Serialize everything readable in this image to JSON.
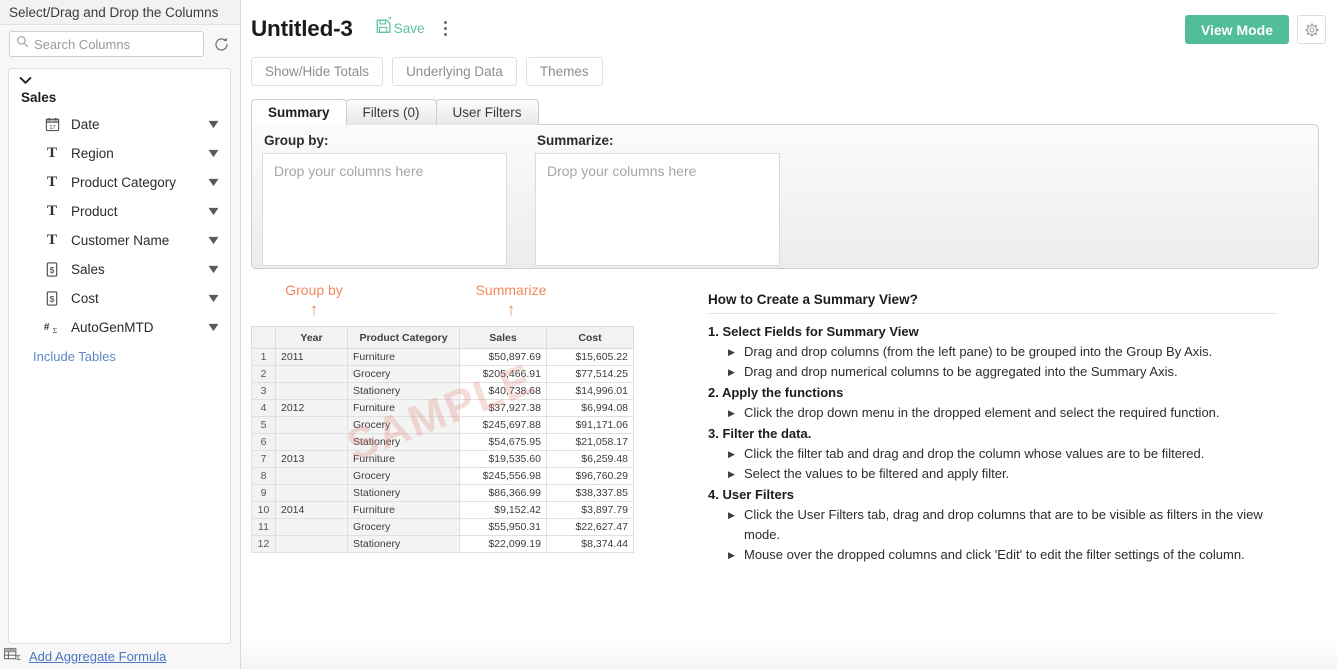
{
  "sidebar": {
    "header": "Select/Drag and Drop the Columns",
    "search": {
      "placeholder": "Search Columns",
      "value": ""
    },
    "refresh_icon": "refresh-icon",
    "group": {
      "name": "Sales",
      "expanded": true
    },
    "columns": [
      {
        "label": "Date",
        "type_icon": "calendar-icon"
      },
      {
        "label": "Region",
        "type_icon": "text-icon"
      },
      {
        "label": "Product Category",
        "type_icon": "text-icon"
      },
      {
        "label": "Product",
        "type_icon": "text-icon"
      },
      {
        "label": "Customer Name",
        "type_icon": "text-icon"
      },
      {
        "label": "Sales",
        "type_icon": "currency-icon"
      },
      {
        "label": "Cost",
        "type_icon": "currency-icon"
      },
      {
        "label": "AutoGenMTD",
        "type_icon": "formula-icon"
      }
    ],
    "include_tables": "Include Tables",
    "add_aggregate_formula": "Add Aggregate Formula"
  },
  "header": {
    "title": "Untitled-3",
    "save_label": "Save",
    "save_icon": "save-icon",
    "kebab_icon": "more-vertical-icon",
    "view_mode_label": "View Mode",
    "settings_icon": "gear-icon",
    "accent_green": "#52bd9a"
  },
  "toolbar": {
    "buttons": [
      {
        "label": "Show/Hide Totals"
      },
      {
        "label": "Underlying Data"
      },
      {
        "label": "Themes"
      }
    ]
  },
  "tabs": [
    {
      "label": "Summary",
      "active": true
    },
    {
      "label": "Filters  (0)",
      "active": false
    },
    {
      "label": "User Filters",
      "active": false
    }
  ],
  "drop_areas": [
    {
      "label": "Group by:",
      "placeholder": "Drop your columns here"
    },
    {
      "label": "Summarize:",
      "placeholder": "Drop your columns here"
    }
  ],
  "annotations": {
    "group_by": "Group by",
    "summarize": "Summarize",
    "arrow": "↑",
    "color": "#f08a5f"
  },
  "sample": {
    "watermark": "SAMPLE",
    "headers": [
      "",
      "Year",
      "Product Category",
      "Sales",
      "Cost"
    ],
    "rows": [
      {
        "idx": "1",
        "year": "2011",
        "category": "Furniture",
        "sales": "$50,897.69",
        "cost": "$15,605.22"
      },
      {
        "idx": "2",
        "year": "",
        "category": "Grocery",
        "sales": "$205,466.91",
        "cost": "$77,514.25"
      },
      {
        "idx": "3",
        "year": "",
        "category": "Stationery",
        "sales": "$40,738.68",
        "cost": "$14,996.01"
      },
      {
        "idx": "4",
        "year": "2012",
        "category": "Furniture",
        "sales": "$37,927.38",
        "cost": "$6,994.08"
      },
      {
        "idx": "5",
        "year": "",
        "category": "Grocery",
        "sales": "$245,697.88",
        "cost": "$91,171.06"
      },
      {
        "idx": "6",
        "year": "",
        "category": "Stationery",
        "sales": "$54,675.95",
        "cost": "$21,058.17"
      },
      {
        "idx": "7",
        "year": "2013",
        "category": "Furniture",
        "sales": "$19,535.60",
        "cost": "$6,259.48"
      },
      {
        "idx": "8",
        "year": "",
        "category": "Grocery",
        "sales": "$245,556.98",
        "cost": "$96,760.29"
      },
      {
        "idx": "9",
        "year": "",
        "category": "Stationery",
        "sales": "$86,366.99",
        "cost": "$38,337.85"
      },
      {
        "idx": "10",
        "year": "2014",
        "category": "Furniture",
        "sales": "$9,152.42",
        "cost": "$3,897.79"
      },
      {
        "idx": "11",
        "year": "",
        "category": "Grocery",
        "sales": "$55,950.31",
        "cost": "$22,627.47"
      },
      {
        "idx": "12",
        "year": "",
        "category": "Stationery",
        "sales": "$22,099.19",
        "cost": "$8,374.44"
      }
    ]
  },
  "howto": {
    "title": "How to Create a Summary View?",
    "steps": [
      {
        "heading": "1. Select Fields for Summary View",
        "bullets": [
          "Drag and drop columns (from the left pane) to be grouped into the Group By Axis.",
          "Drag and drop numerical columns to be aggregated into the Summary Axis."
        ]
      },
      {
        "heading": "2. Apply the functions",
        "bullets": [
          "Click the drop down menu in the dropped element and select the required function."
        ]
      },
      {
        "heading": "3. Filter the data.",
        "bullets": [
          "Click the filter tab and drag and drop the column whose values are to be filtered.",
          "Select the values to be filtered and apply filter."
        ]
      },
      {
        "heading": "4. User Filters",
        "bullets": [
          "Click the User Filters tab, drag and drop columns that are to be visible as filters in the view mode.",
          "Mouse over the dropped columns and click 'Edit' to edit the filter settings of the column."
        ]
      }
    ]
  }
}
